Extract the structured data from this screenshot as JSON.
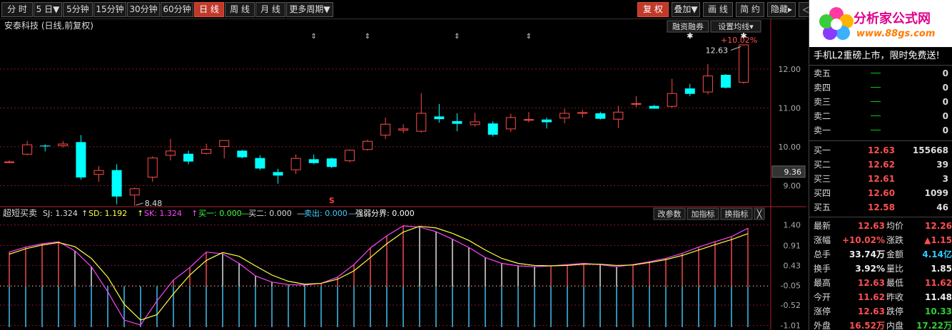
{
  "toolbar": {
    "periods": [
      "分 时",
      "5 日▼",
      "5分钟",
      "15分钟",
      "30分钟",
      "60分钟",
      "日 线",
      "周 线",
      "月 线",
      "更多周期▼"
    ],
    "active_period": 6,
    "right_buttons": [
      "复 权",
      "叠加▼",
      "画 线",
      "简 约",
      "隐藏▸",
      "◁▷"
    ]
  },
  "main": {
    "title": "安泰科技 (日线,前复权)",
    "btn_margin": "融资融券",
    "btn_ma": "设置均线▾",
    "peak_label": "12.63",
    "low_label": "8.48",
    "current_price_tag": "9.36",
    "top_right_overlay": "+10.02%",
    "s_mark": "S"
  },
  "chart_data": [
    {
      "type": "candlestick",
      "title": "安泰科技 (日线,前复权)",
      "ylim": [
        8.55,
        12.95
      ],
      "yticks": [
        9.0,
        10.0,
        11.0,
        12.0
      ],
      "annotations": {
        "max": 12.63,
        "min": 8.48
      },
      "colors": {
        "up": "#ff4a4a",
        "down": "#00ffff"
      },
      "ohlc": [
        [
          9.61,
          9.65,
          9.58,
          9.62
        ],
        [
          9.8,
          10.15,
          9.78,
          10.06
        ],
        [
          10.03,
          10.06,
          9.88,
          10.01
        ],
        [
          10.02,
          10.15,
          9.98,
          10.08
        ],
        [
          10.12,
          10.3,
          9.15,
          9.21
        ],
        [
          9.28,
          9.5,
          9.1,
          9.4
        ],
        [
          9.4,
          9.55,
          8.52,
          8.72
        ],
        [
          8.75,
          8.95,
          8.48,
          8.93
        ],
        [
          9.21,
          9.75,
          9.1,
          9.72
        ],
        [
          9.77,
          10.2,
          9.65,
          9.9
        ],
        [
          9.82,
          9.9,
          9.55,
          9.62
        ],
        [
          9.82,
          10.08,
          9.8,
          9.94
        ],
        [
          10.0,
          10.17,
          9.7,
          10.17
        ],
        [
          9.9,
          9.92,
          9.7,
          9.73
        ],
        [
          9.71,
          9.78,
          9.4,
          9.44
        ],
        [
          9.35,
          9.43,
          9.05,
          9.26
        ],
        [
          9.4,
          9.8,
          9.3,
          9.71
        ],
        [
          9.68,
          9.8,
          9.55,
          9.58
        ],
        [
          9.7,
          9.72,
          9.45,
          9.48
        ],
        [
          9.63,
          9.93,
          9.6,
          9.92
        ],
        [
          9.92,
          10.18,
          9.9,
          10.15
        ],
        [
          10.29,
          10.75,
          10.2,
          10.59
        ],
        [
          10.42,
          10.58,
          10.35,
          10.47
        ],
        [
          10.39,
          11.38,
          10.36,
          10.87
        ],
        [
          10.78,
          11.1,
          10.62,
          10.71
        ],
        [
          10.66,
          10.86,
          10.4,
          10.59
        ],
        [
          10.56,
          10.87,
          10.52,
          10.65
        ],
        [
          10.6,
          10.66,
          10.26,
          10.31
        ],
        [
          10.45,
          10.85,
          10.38,
          10.76
        ],
        [
          10.71,
          10.89,
          10.63,
          10.71
        ],
        [
          10.7,
          10.75,
          10.47,
          10.63
        ],
        [
          10.73,
          10.98,
          10.6,
          10.87
        ],
        [
          10.85,
          10.95,
          10.75,
          10.89
        ],
        [
          10.86,
          10.9,
          10.7,
          10.72
        ],
        [
          10.7,
          11.05,
          10.48,
          10.9
        ],
        [
          11.09,
          11.3,
          11.02,
          11.12
        ],
        [
          11.05,
          11.08,
          10.98,
          10.98
        ],
        [
          11.03,
          11.75,
          11.0,
          11.38
        ],
        [
          11.5,
          11.62,
          11.3,
          11.36
        ],
        [
          11.4,
          12.13,
          11.35,
          11.83
        ],
        [
          11.85,
          11.87,
          11.5,
          11.52
        ],
        [
          11.65,
          12.63,
          11.62,
          12.63
        ]
      ]
    },
    {
      "type": "line",
      "title": "超短买卖",
      "legend": [
        {
          "label": "SJ: 1.324",
          "color": "#dddddd"
        },
        {
          "label": "SD: 1.192",
          "color": "#ffff44"
        },
        {
          "label": "SK: 1.324",
          "color": "#ff44ff"
        },
        {
          "label": "买一: 0.000",
          "color": "#44ff44"
        },
        {
          "label": "买二: 0.000",
          "color": "#dddddd"
        },
        {
          "label": "卖出: 0.000",
          "color": "#44ccff"
        },
        {
          "label": "强弱分界: 0.000",
          "color": "#ffffff"
        }
      ],
      "buttons": [
        "改参数",
        "加指标",
        "换指标",
        "╳"
      ],
      "ylim": [
        -1.05,
        1.48
      ],
      "yticks": [
        1.4,
        0.91,
        0.43,
        -0.05,
        -0.52,
        -1.01
      ],
      "series": [
        {
          "name": "SK",
          "color": "#ff44ff",
          "values": [
            0.75,
            0.87,
            0.95,
            1.0,
            0.78,
            0.4,
            -0.2,
            -0.88,
            -1.0,
            -0.42,
            0.08,
            0.38,
            0.75,
            0.71,
            0.48,
            0.18,
            0.03,
            -0.03,
            -0.04,
            0.0,
            0.15,
            0.45,
            0.85,
            1.14,
            1.38,
            1.35,
            1.24,
            1.06,
            0.86,
            0.62,
            0.48,
            0.42,
            0.4,
            0.42,
            0.45,
            0.48,
            0.45,
            0.4,
            0.45,
            0.52,
            0.6,
            0.72,
            0.87,
            1.0,
            1.12,
            1.324
          ]
        },
        {
          "name": "SD",
          "color": "#ffff44",
          "values": [
            0.7,
            0.83,
            0.92,
            0.98,
            0.88,
            0.6,
            0.15,
            -0.5,
            -0.88,
            -0.75,
            -0.25,
            0.2,
            0.55,
            0.74,
            0.65,
            0.42,
            0.2,
            0.05,
            -0.02,
            0.0,
            0.1,
            0.3,
            0.62,
            0.95,
            1.23,
            1.37,
            1.33,
            1.2,
            1.03,
            0.8,
            0.6,
            0.48,
            0.43,
            0.42,
            0.43,
            0.46,
            0.46,
            0.43,
            0.44,
            0.5,
            0.57,
            0.67,
            0.8,
            0.93,
            1.05,
            1.192
          ]
        },
        {
          "name": "SJ",
          "color": "#dddddd",
          "bars": [
            0.75,
            0.87,
            0.95,
            1.0,
            0.78,
            0.4,
            -0.2,
            -0.88,
            -1.0,
            -0.42,
            0.08,
            0.38,
            0.75,
            0.71,
            0.48,
            0.18,
            0.03,
            -0.03,
            -0.04,
            0.0,
            0.15,
            0.45,
            0.85,
            1.14,
            1.38,
            1.35,
            1.24,
            1.06,
            0.86,
            0.62,
            0.48,
            0.42,
            0.4,
            0.42,
            0.45,
            0.48,
            0.45,
            0.4,
            0.45,
            0.52,
            0.6,
            0.72,
            0.87,
            1.0,
            1.12,
            1.324
          ]
        }
      ],
      "buy_markers": [
        8,
        17
      ],
      "colors": {
        "bar_up": "#ff5050",
        "bar_down": "#44ccff",
        "bar_white": "#eeeeee",
        "buy": "#44ff44"
      }
    }
  ],
  "orderbook": {
    "promo": "手机L2重磅上市，限时免费送!",
    "sell": [
      {
        "label": "卖五",
        "price": "—",
        "vol": "0"
      },
      {
        "label": "卖四",
        "price": "—",
        "vol": "0"
      },
      {
        "label": "卖三",
        "price": "—",
        "vol": "0"
      },
      {
        "label": "卖二",
        "price": "—",
        "vol": "0"
      },
      {
        "label": "卖一",
        "price": "—",
        "vol": "0"
      }
    ],
    "buy": [
      {
        "label": "买一",
        "price": "12.63",
        "vol": "155668"
      },
      {
        "label": "买二",
        "price": "12.62",
        "vol": "39"
      },
      {
        "label": "买三",
        "price": "12.61",
        "vol": "3"
      },
      {
        "label": "买四",
        "price": "12.60",
        "vol": "1099"
      },
      {
        "label": "买五",
        "price": "12.58",
        "vol": "46"
      }
    ]
  },
  "stats": [
    {
      "l1": "最新",
      "v1": "12.63",
      "c1": "red",
      "l2": "均价",
      "v2": "12.26",
      "c2": "red"
    },
    {
      "l1": "涨幅",
      "v1": "+10.02%",
      "c1": "red",
      "l2": "涨跌",
      "v2": "▲1.15",
      "c2": "red"
    },
    {
      "l1": "总手",
      "v1": "33.74万",
      "c1": "white",
      "l2": "金额",
      "v2": "4.14亿",
      "c2": "cyan"
    },
    {
      "l1": "换手",
      "v1": "3.92%",
      "c1": "white",
      "l2": "量比",
      "v2": "1.85",
      "c2": "white"
    },
    {
      "l1": "最高",
      "v1": "12.63",
      "c1": "red",
      "l2": "最低",
      "v2": "11.62",
      "c2": "red"
    },
    {
      "l1": "今开",
      "v1": "11.62",
      "c1": "red",
      "l2": "昨收",
      "v2": "11.48",
      "c2": "white"
    },
    {
      "l1": "涨停",
      "v1": "12.63",
      "c1": "red",
      "l2": "跌停",
      "v2": "10.33",
      "c2": "green"
    },
    {
      "l1": "外盘",
      "v1": "16.52万",
      "c1": "red",
      "l2": "内盘",
      "v2": "17.22万",
      "c2": "green"
    }
  ],
  "logo": {
    "name": "分析家公式网",
    "url": "www.88gs.com"
  }
}
